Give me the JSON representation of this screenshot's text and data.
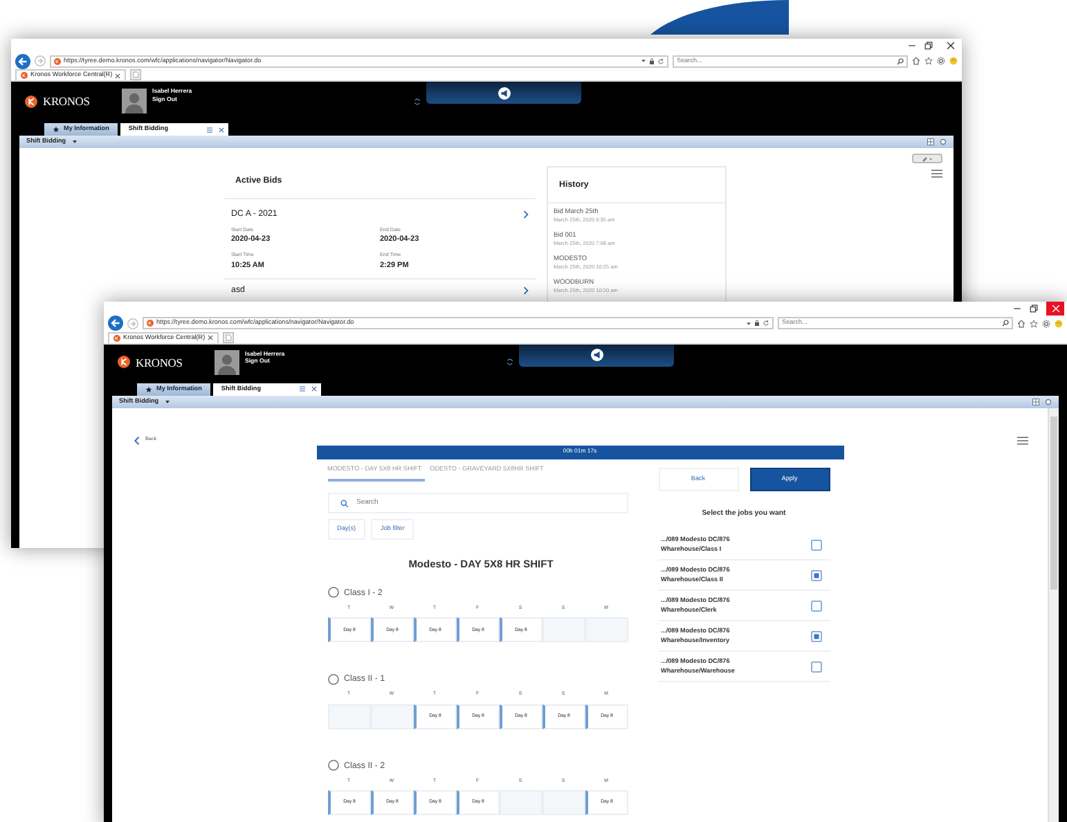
{
  "back_window": {
    "active": false,
    "browser": {
      "url": "https://tyree.demo.kronos.com/wfc/applications/navigator/Navigator.do",
      "search_placeholder": "Search...",
      "tab": "Kronos Workforce Central(R)"
    },
    "app": {
      "logo": "KRONOS",
      "user": "Isabel Herrera",
      "sign_out": "Sign Out",
      "nav_tabs": [
        {
          "label": "My Information",
          "selected": false
        },
        {
          "label": "Shift Bidding",
          "selected": true
        }
      ],
      "page_menu": "Shift Bidding"
    },
    "active_bids": {
      "title": "Active Bids",
      "bids": [
        {
          "name": "DC A - 2021",
          "fields": [
            {
              "label": "Start Date",
              "value": "2020-04-23"
            },
            {
              "label": "End Date",
              "value": "2020-04-23"
            },
            {
              "label": "Start Time",
              "value": "10:25 AM"
            },
            {
              "label": "End Time",
              "value": "2:29 PM"
            }
          ]
        },
        {
          "name": "asd"
        }
      ]
    },
    "history": {
      "title": "History",
      "entries": [
        {
          "name": "Bid March 25th",
          "time": "March 25th, 2020 6:35 am"
        },
        {
          "name": "Bid 001",
          "time": "March 25th, 2020 7:08 am"
        },
        {
          "name": "MODESTO",
          "time": "March 25th, 2020 10:25 am"
        },
        {
          "name": "WOODBURN",
          "time": "March 25th, 2020 10:50 am"
        }
      ]
    }
  },
  "front_window": {
    "active": true,
    "browser": {
      "url": "https://tyree.demo.kronos.com/wfc/applications/navigator/Navigator.do",
      "search_placeholder": "Search...",
      "tab": "Kronos Workforce Central(R)"
    },
    "app": {
      "logo": "KRONOS",
      "user": "Isabel Herrera",
      "sign_out": "Sign Out",
      "nav_tabs": [
        {
          "label": "My Information",
          "selected": false
        },
        {
          "label": "Shift Bidding",
          "selected": true
        }
      ],
      "page_menu": "Shift Bidding"
    },
    "back_link": "Back",
    "timer": "00h 01m 17s",
    "shift_tabs": [
      {
        "label": "MODESTO - DAY 5X8 HR SHIFT",
        "selected": true
      },
      {
        "label": "ODESTO - GRAVEYARD 5X8HR SHIFT",
        "selected": false
      }
    ],
    "search_placeholder": "Search",
    "filters": [
      "Day(s)",
      "Job filter"
    ],
    "heading": "Modesto - DAY 5X8 HR SHIFT",
    "classes": [
      {
        "name": "Class I - 2",
        "selected": false,
        "days": [
          {
            "day": "T",
            "shift": "Day 8"
          },
          {
            "day": "W",
            "shift": "Day 8"
          },
          {
            "day": "T",
            "shift": "Day 8"
          },
          {
            "day": "F",
            "shift": "Day 8"
          },
          {
            "day": "S",
            "shift": "Day 8"
          },
          {
            "day": "S"
          },
          {
            "day": "M"
          }
        ]
      },
      {
        "name": "Class II - 1",
        "selected": false,
        "days": [
          {
            "day": "T"
          },
          {
            "day": "W"
          },
          {
            "day": "T",
            "shift": "Day 8"
          },
          {
            "day": "F",
            "shift": "Day 8"
          },
          {
            "day": "S",
            "shift": "Day 8"
          },
          {
            "day": "S",
            "shift": "Day 8"
          },
          {
            "day": "M",
            "shift": "Day 8"
          }
        ]
      },
      {
        "name": "Class II - 2",
        "selected": false,
        "days": [
          {
            "day": "T",
            "shift": "Day 8"
          },
          {
            "day": "W",
            "shift": "Day 8"
          },
          {
            "day": "T",
            "shift": "Day 8"
          },
          {
            "day": "F",
            "shift": "Day 8"
          },
          {
            "day": "S"
          },
          {
            "day": "S"
          },
          {
            "day": "M",
            "shift": "Day 8"
          }
        ]
      }
    ],
    "back_button": "Back",
    "apply_button": "Apply",
    "jobs_title": "Select the jobs you want",
    "jobs": [
      {
        "path": ".../089 Modesto DC/876",
        "job": "Wharehouse/Class I",
        "checked": false
      },
      {
        "path": ".../089 Modesto DC/876",
        "job": "Wharehouse/Class II",
        "checked": true
      },
      {
        "path": ".../089 Modesto DC/876",
        "job": "Wharehouse/Clerk",
        "checked": false
      },
      {
        "path": ".../089 Modesto DC/876",
        "job": "Wharehouse/Inventory",
        "checked": true
      },
      {
        "path": ".../089 Modesto DC/876",
        "job": "Wharehouse/Warehouse",
        "checked": false
      }
    ]
  }
}
